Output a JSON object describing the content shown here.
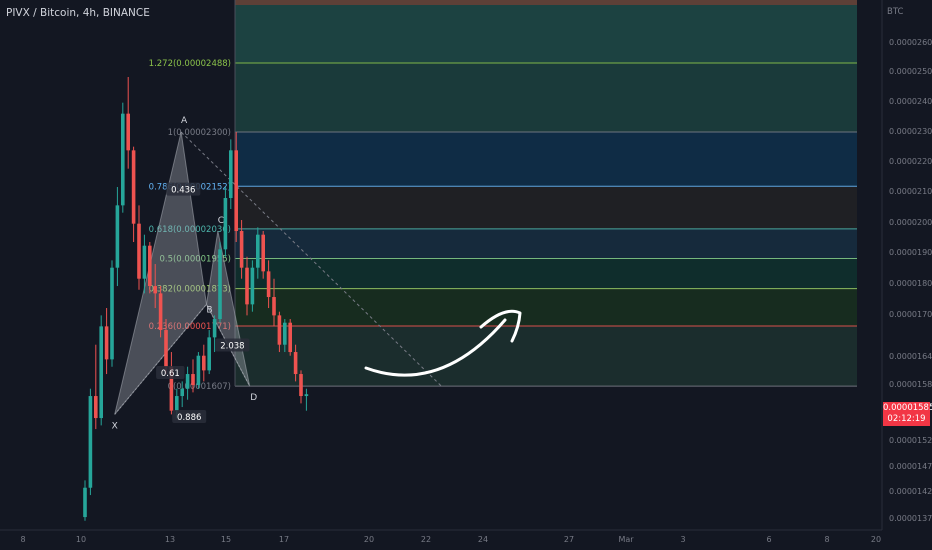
{
  "header": {
    "title": "PIVX / Bitcoin, 4h, BINANCE"
  },
  "price_axis": {
    "unit": "BTC"
  },
  "last_price": {
    "value": "0.00001585",
    "countdown": "02:12:19"
  },
  "colors": {
    "background": "#131722",
    "up": "#26a69a",
    "down": "#ef5350",
    "pattern_fill": "#b2b5be",
    "arrow": "#ffffff",
    "badge": "#f23645"
  },
  "chart_data": {
    "type": "candlestick",
    "title": "PIVX / Bitcoin, 4h, BINANCE",
    "y_unit": "BTC",
    "ylim": [
      1.35e-05,
      2.72e-05
    ],
    "y_ticks": [
      "0.00002600",
      "0.00002500",
      "0.00002400",
      "0.00002300",
      "0.00002200",
      "0.00002100",
      "0.00002000",
      "0.00001900",
      "0.00001800",
      "0.00001700",
      "0.00001640",
      "0.00001580",
      "0.00001520",
      "0.00001470",
      "0.00001420",
      "0.00001370"
    ],
    "x_ticks": [
      "8",
      "10",
      "13",
      "15",
      "17",
      "20",
      "22",
      "24",
      "27",
      "Mar",
      "3",
      "6",
      "8",
      "20"
    ],
    "grid": false,
    "candles": [
      [
        1.25e-05,
        1.35e-05,
        1.24e-05,
        1.33e-05
      ],
      [
        1.33e-05,
        1.6e-05,
        1.31e-05,
        1.58e-05
      ],
      [
        1.58e-05,
        1.72e-05,
        1.49e-05,
        1.52e-05
      ],
      [
        1.52e-05,
        1.8e-05,
        1.5e-05,
        1.77e-05
      ],
      [
        1.77e-05,
        1.82e-05,
        1.64e-05,
        1.68e-05
      ],
      [
        1.68e-05,
        1.95e-05,
        1.66e-05,
        1.93e-05
      ],
      [
        1.93e-05,
        2.15e-05,
        1.88e-05,
        2.1e-05
      ],
      [
        2.1e-05,
        2.38e-05,
        2.08e-05,
        2.35e-05
      ],
      [
        2.35e-05,
        2.45e-05,
        2.2e-05,
        2.25e-05
      ],
      [
        2.25e-05,
        2.26e-05,
        2e-05,
        2.05e-05
      ],
      [
        2.05e-05,
        2.1e-05,
        1.87e-05,
        1.9e-05
      ],
      [
        1.9e-05,
        2.02e-05,
        1.86e-05,
        1.99e-05
      ],
      [
        1.99e-05,
        2e-05,
        1.86e-05,
        1.88e-05
      ],
      [
        1.88e-05,
        1.94e-05,
        1.82e-05,
        1.86e-05
      ],
      [
        1.86e-05,
        1.88e-05,
        1.74e-05,
        1.76e-05
      ],
      [
        1.76e-05,
        1.79e-05,
        1.64e-05,
        1.66e-05
      ],
      [
        1.66e-05,
        1.7e-05,
        1.53e-05,
        1.54e-05
      ],
      [
        1.54e-05,
        1.6e-05,
        1.52e-05,
        1.58e-05
      ],
      [
        1.58e-05,
        1.62e-05,
        1.55e-05,
        1.6e-05
      ],
      [
        1.6e-05,
        1.66e-05,
        1.57e-05,
        1.64e-05
      ],
      [
        1.64e-05,
        1.68e-05,
        1.59e-05,
        1.61e-05
      ],
      [
        1.61e-05,
        1.7e-05,
        1.6e-05,
        1.69e-05
      ],
      [
        1.69e-05,
        1.72e-05,
        1.62e-05,
        1.65e-05
      ],
      [
        1.65e-05,
        1.76e-05,
        1.64e-05,
        1.74e-05
      ],
      [
        1.74e-05,
        1.8e-05,
        1.7e-05,
        1.79e-05
      ],
      [
        1.79e-05,
        2e-05,
        1.78e-05,
        1.98e-05
      ],
      [
        1.98e-05,
        2.15e-05,
        1.96e-05,
        2.12e-05
      ],
      [
        2.12e-05,
        2.28e-05,
        2.09e-05,
        2.25e-05
      ],
      [
        2.25e-05,
        2.3e-05,
        2e-05,
        2.03e-05
      ],
      [
        2.03e-05,
        2.06e-05,
        1.9e-05,
        1.93e-05
      ],
      [
        1.93e-05,
        1.96e-05,
        1.8e-05,
        1.83e-05
      ],
      [
        1.83e-05,
        1.95e-05,
        1.81e-05,
        1.93e-05
      ],
      [
        1.93e-05,
        2.04e-05,
        1.9e-05,
        2.02e-05
      ],
      [
        2.02e-05,
        2.03e-05,
        1.9e-05,
        1.92e-05
      ],
      [
        1.92e-05,
        1.95e-05,
        1.82e-05,
        1.85e-05
      ],
      [
        1.85e-05,
        1.9e-05,
        1.77e-05,
        1.8e-05
      ],
      [
        1.8e-05,
        1.81e-05,
        1.7e-05,
        1.72e-05
      ],
      [
        1.72e-05,
        1.79e-05,
        1.7e-05,
        1.78e-05
      ],
      [
        1.78e-05,
        1.79e-05,
        1.69e-05,
        1.7e-05
      ],
      [
        1.7e-05,
        1.72e-05,
        1.62e-05,
        1.64e-05
      ],
      [
        1.64e-05,
        1.65e-05,
        1.56e-05,
        1.58e-05
      ],
      [
        1.58e-05,
        1.6e-05,
        1.54e-05,
        1.585e-05
      ]
    ],
    "fib_levels": [
      {
        "label": "1.272(0.00002488)",
        "ratio": 1.272,
        "price": 2.488e-05,
        "color": "#8bc34a",
        "fill": "#1a3a3a"
      },
      {
        "label": "1(0.00002300)",
        "ratio": 1,
        "price": 2.3e-05,
        "color": "#787b86",
        "fill": "#0f2c45"
      },
      {
        "label": "0.786(0.00002152)",
        "ratio": 0.786,
        "price": 2.152e-05,
        "color": "#64b5f6",
        "fill": "#1f2024"
      },
      {
        "label": "0.618(0.00002036)",
        "ratio": 0.618,
        "price": 2.036e-05,
        "color": "#4db6ac",
        "fill": "#162a3c"
      },
      {
        "label": "0.5(0.00001955)",
        "ratio": 0.5,
        "price": 1.955e-05,
        "color": "#81c784",
        "fill": "#0f2d2c"
      },
      {
        "label": "0.382(0.00001873)",
        "ratio": 0.382,
        "price": 1.873e-05,
        "color": "#9ccc65",
        "fill": "#172c1f"
      },
      {
        "label": "0.236(0.00001771)",
        "ratio": 0.236,
        "price": 1.771e-05,
        "color": "#ef5350",
        "fill": "#1b2d2d"
      },
      {
        "label": "0(0.00001607)",
        "ratio": 0,
        "price": 1.607e-05,
        "color": "#787b86",
        "fill": "#3b1517"
      }
    ],
    "top_level_price": 2.7e-05,
    "fib_labels_visible": [
      "1.272(0.00002488)",
      "1(0.00002300)",
      "0.786(0.00002152)",
      "0.618(0.00002036)",
      "0.5(0.00001955)",
      "0.382(0.00001873)",
      "0.236(0.00001771)",
      "0(0.00001607)"
    ],
    "pattern": {
      "points": [
        {
          "label": "X",
          "bar": 5.5,
          "price": 1.53e-05
        },
        {
          "label": "A",
          "bar": 17.8,
          "price": 2.3e-05
        },
        {
          "label": "B",
          "bar": 22.5,
          "price": 1.83e-05
        },
        {
          "label": "C",
          "bar": 24.6,
          "price": 2.03e-05
        },
        {
          "label": "D",
          "bar": 30.5,
          "price": 1.607e-05
        }
      ],
      "ratios": [
        {
          "text": "0.436",
          "bar": 18.2,
          "price": 2.14e-05
        },
        {
          "text": "0.61",
          "bar": 15.8,
          "price": 1.64e-05
        },
        {
          "text": "2.038",
          "bar": 27.3,
          "price": 1.715e-05
        },
        {
          "text": "0.886",
          "bar": 19.3,
          "price": 1.52e-05
        }
      ]
    },
    "trendline": {
      "from_bar": 17.8,
      "from_price": 2.3e-05,
      "to_bar": 66,
      "to_price": 1.607e-05
    }
  }
}
